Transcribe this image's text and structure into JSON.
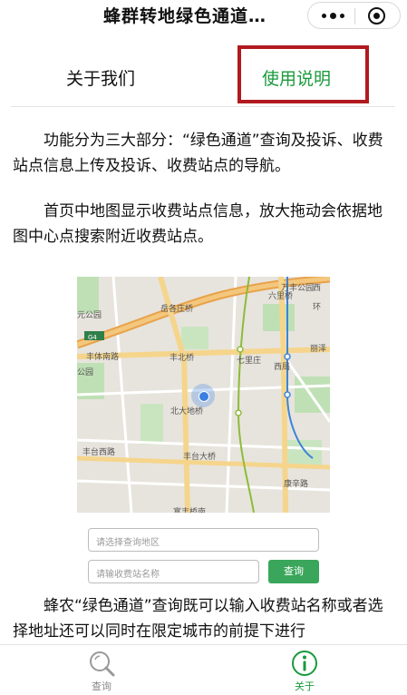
{
  "window": {
    "title": "蜂群转地绿色通道…"
  },
  "tabs": [
    {
      "label": "关于我们",
      "active": false
    },
    {
      "label": "使用说明",
      "active": true
    }
  ],
  "content": {
    "p1": "功能分为三大部分：“绿色通道”查询及投诉、收费站点信息上传及投诉、收费站点的导航。",
    "p2": "首页中地图显示收费站点信息，放大拖动会依据地图中心点搜索附近收费站点。",
    "p3": "蜂农“绿色通道”查询既可以输入收费站名称或者选择地址还可以同时在限定城市的前提下进行"
  },
  "screenshot": {
    "map_labels": {
      "gz": "元公园",
      "yg": "岳各庄桥",
      "fz": "丰体南路",
      "fb": "丰北桥",
      "qlz": "七里庄",
      "xj": "西局",
      "lz": "丽泽",
      "gy": "公园",
      "bd": "北大地桥",
      "fxl": "丰台西路",
      "ftq": "丰台大桥",
      "kx": "康辛路",
      "xh": "富丰桥南",
      "dz": "万丰公园",
      "lk": "六里桥",
      "x4": "西",
      "g4": "G4",
      "h4": "环"
    },
    "area_placeholder": "请选择查询地区",
    "station_placeholder": "请输收费站名称",
    "query_button": "查询"
  },
  "tabbar": [
    {
      "label": "查询",
      "icon": "search-icon",
      "active": false
    },
    {
      "label": "关于",
      "icon": "info-icon",
      "active": true
    }
  ],
  "colors": {
    "accent_green": "#1a9a3c",
    "highlight_red": "#b1191e",
    "button_green": "#3aa65b"
  }
}
